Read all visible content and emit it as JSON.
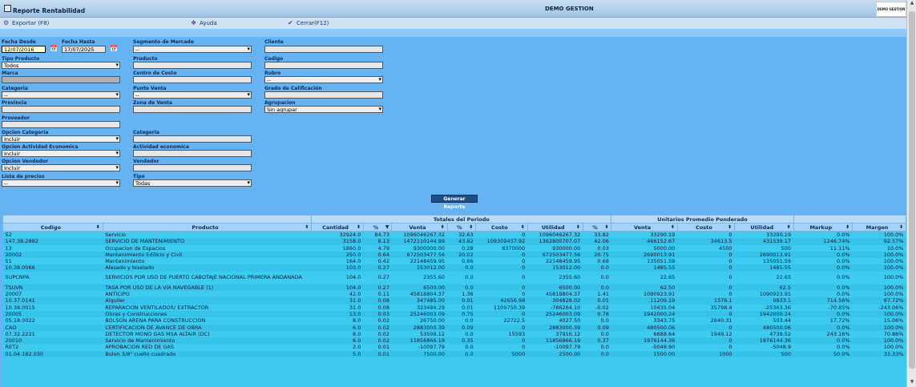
{
  "window": {
    "title": "Reporte Rentabilidad",
    "company": "DEMO GESTION",
    "logo_text": "DEMO GESTION"
  },
  "toolbar": {
    "export": "Exportar (F8)",
    "help": "Ayuda",
    "close": "Cerrar(F12)"
  },
  "filters": {
    "fecha_desde": {
      "label": "Fecha Desde",
      "value": "12/07/2016"
    },
    "fecha_hasta": {
      "label": "Fecha Hasta",
      "value": "17/07/2025"
    },
    "segmento": {
      "label": "Segmento de Mercado",
      "value": "--"
    },
    "cliente": {
      "label": "Cliente",
      "value": ""
    },
    "tipo_producto": {
      "label": "Tipo Producto",
      "value": "Todos"
    },
    "producto": {
      "label": "Producto",
      "value": ""
    },
    "codigo": {
      "label": "Codigo",
      "value": ""
    },
    "marca": {
      "label": "Marca",
      "value": ""
    },
    "centro_costo": {
      "label": "Centro de Costo",
      "value": ""
    },
    "rubro": {
      "label": "Rubro",
      "value": "--"
    },
    "categoria": {
      "label": "Categoria",
      "value": "--"
    },
    "punto_venta": {
      "label": "Punto Venta",
      "value": "--"
    },
    "grado_calificacion": {
      "label": "Grado de Calificación",
      "value": ""
    },
    "provincia": {
      "label": "Provincia",
      "value": ""
    },
    "zona_venta": {
      "label": "Zona de Venta",
      "value": ""
    },
    "agrupacion": {
      "label": "Agrupacion",
      "value": "Sin agrupar"
    },
    "proveedor": {
      "label": "Proveedor",
      "value": ""
    },
    "opcion_categoria": {
      "label": "Opcion Categoria",
      "value": "Incluir"
    },
    "categoria2": {
      "label": "Categoria",
      "value": ""
    },
    "opcion_actividad": {
      "label": "Opcion Actividad Economica",
      "value": "Incluir"
    },
    "actividad": {
      "label": "Actividad economica",
      "value": ""
    },
    "opcion_vendedor": {
      "label": "Opcion Vendedor",
      "value": "Incluir"
    },
    "vendedor": {
      "label": "Vendedor",
      "value": ""
    },
    "lista_precios": {
      "label": "Lista de precios",
      "value": "--"
    },
    "tipo": {
      "label": "Tipo",
      "value": "Todas"
    },
    "generate_button": "Generar Reporte"
  },
  "grid": {
    "group_headers": {
      "totales": "Totales del Periodo",
      "unitarios": "Unitarios Promedio Ponderado"
    },
    "columns": [
      "Codigo",
      "Producto",
      "Cantidad",
      "% ",
      "Venta",
      "% ",
      "Costo",
      "Utilidad",
      "% ",
      "Venta",
      "Costo",
      "Utilidad",
      "Markup",
      "Margen"
    ],
    "rows": [
      [
        "52",
        "Servicio",
        "32924.0",
        "84.73",
        "1096046267.32",
        "32.63",
        "0",
        "1096046267.32",
        "33.82",
        "33290.19",
        "0",
        "33290.19",
        "0.0%",
        "100.0%"
      ],
      [
        "147.38.2882",
        "SERVICIO DE MANTENIMIENTO",
        "3158.0",
        "8.13",
        "1472110144.99",
        "43.82",
        "109309437.92",
        "1362800707.07",
        "42.06",
        "466152.67",
        "34613.5",
        "431539.17",
        "1246.74%",
        "92.57%"
      ],
      [
        "13",
        "Ocupacion de Espacios",
        "1860.0",
        "4.79",
        "9300000.00",
        "0.28",
        "8370000",
        "930000.00",
        "0.03",
        "5000.00",
        "4500",
        "500",
        "11.11%",
        "10.0%"
      ],
      [
        "20002",
        "Mantenimiento Edilicio y Civil",
        "250.0",
        "0.64",
        "672503477.56",
        "20.02",
        "0",
        "672503477.56",
        "20.75",
        "2690013.91",
        "0",
        "2690013.91",
        "0.0%",
        "100.0%"
      ],
      [
        "51",
        "Mantenimiento",
        "164.0",
        "0.42",
        "22148459.95",
        "0.66",
        "0",
        "22148459.95",
        "0.68",
        "135051.59",
        "0",
        "135051.59",
        "0.0%",
        "100.0%"
      ],
      [
        "10.38.0066",
        "Alesado y biselado",
        "103.0",
        "0.27",
        "153012.00",
        "0.0",
        "0",
        "153012.00",
        "0.0",
        "1485.55",
        "0",
        "1485.55",
        "0.0%",
        "100.0%"
      ],
      [
        "SUPCNPA",
        "SERVICIOS POR USO DE PUERTO CABOTAJE NACIONAL PRIMERA ANDANADA",
        "104.0",
        "0.27",
        "2355.60",
        "0.0",
        "0",
        "2355.60",
        "0.0",
        "22.65",
        "0",
        "22.65",
        "0.0%",
        "100.0%"
      ],
      [
        "TSUVN",
        "TASA POR USO DE LA VÍA NAVEGABLE (1)",
        "104.0",
        "0.27",
        "6500.00",
        "0.0",
        "0",
        "6500.00",
        "0.0",
        "62.50",
        "0",
        "62.5",
        "0.0%",
        "100.0%"
      ],
      [
        "20007",
        "ANTICIPO",
        "42.0",
        "0.11",
        "45818804.37",
        "1.36",
        "0",
        "45818804.37",
        "1.41",
        "1090923.91",
        "0",
        "1090923.91",
        "0.0%",
        "100.0%"
      ],
      [
        "10.37.0141",
        "Alquiler",
        "31.0",
        "0.08",
        "347485.00",
        "0.01",
        "42656.98",
        "304828.02",
        "0.01",
        "11209.19",
        "1376.1",
        "9833.1",
        "714.56%",
        "87.72%"
      ],
      [
        "10.38.0015",
        "REPARACION VENTILADOR/ EXTRACTOR",
        "31.0",
        "0.08",
        "323486.29",
        "0.01",
        "1109750.39",
        "-786264.10",
        "-0.02",
        "10435.04",
        "35798.4",
        "-25363.36",
        "-70.85%",
        "-243.06%"
      ],
      [
        "20005",
        "Obras y Construcciones",
        "13.0",
        "0.03",
        "25246003.09",
        "0.75",
        "0",
        "25246003.09",
        "0.78",
        "1942000.24",
        "0",
        "1942000.24",
        "0.0%",
        "100.0%"
      ],
      [
        "05.18.0022",
        "BOLSON ARENA PARA CONSTRUCCION",
        "8.0",
        "0.02",
        "26750.00",
        "0.0",
        "22722.5",
        "4027.50",
        "0.0",
        "3343.75",
        "2840.31",
        "503.44",
        "17.72%",
        "15.06%"
      ],
      [
        "CAO",
        "CERTIFICACION DE AVANCE DE OBRA",
        "6.0",
        "0.02",
        "2883000.39",
        "0.09",
        "0",
        "2883000.39",
        "0.09",
        "480500.06",
        "0",
        "480500.06",
        "0.0%",
        "100.0%"
      ],
      [
        "07.32.2221",
        "DETECTOR MONO GAS MSA ALTAIR (DC)",
        "8.0",
        "0.02",
        "53509.12",
        "0.0",
        "15593",
        "37916.12",
        "0.0",
        "6688.64",
        "1949.12",
        "4739.52",
        "243.16%",
        "70.86%"
      ],
      [
        "20010",
        "Servicio de Mantenimiento",
        "6.0",
        "0.02",
        "11856866.19",
        "0.35",
        "0",
        "11856866.19",
        "0.37",
        "1976144.36",
        "0",
        "1976144.36",
        "0.0%",
        "100.0%"
      ],
      [
        "RET2",
        "APROBACION RED DE GAS",
        "2.0",
        "0.01",
        "-10097.79",
        "0.0",
        "0",
        "-10097.79",
        "0.0",
        "-5048.90",
        "0",
        "-5048.9",
        "0.0%",
        "100.0%"
      ],
      [
        "01.04.182.030",
        "Bulon 3/8\" cuello cuadrado",
        "5.0",
        "0.01",
        "7500.00",
        "0.0",
        "5000",
        "2500.00",
        "0.0",
        "1500.00",
        "1000",
        "500",
        "50.0%",
        "33.33%"
      ]
    ]
  }
}
